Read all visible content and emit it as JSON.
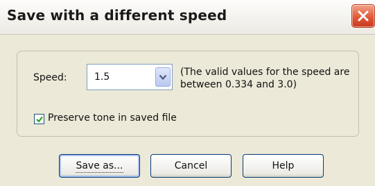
{
  "dialog": {
    "title": "Save with a different speed"
  },
  "speed": {
    "label": "Speed:",
    "value": "1.5",
    "hint": "(The valid values for the speed are between 0.334 and 3.0)"
  },
  "preserve_tone": {
    "label": "Preserve tone in saved file",
    "checked": true
  },
  "buttons": {
    "save_as": "Save as...",
    "cancel": "Cancel",
    "help": "Help"
  },
  "icons": {
    "close": "close-icon",
    "dropdown": "chevron-down-icon",
    "check": "checkmark-icon"
  },
  "colors": {
    "close_button": "#e0593a",
    "checkmark": "#21a121",
    "combo_border": "#7f9db9",
    "button_border": "#003c74"
  }
}
